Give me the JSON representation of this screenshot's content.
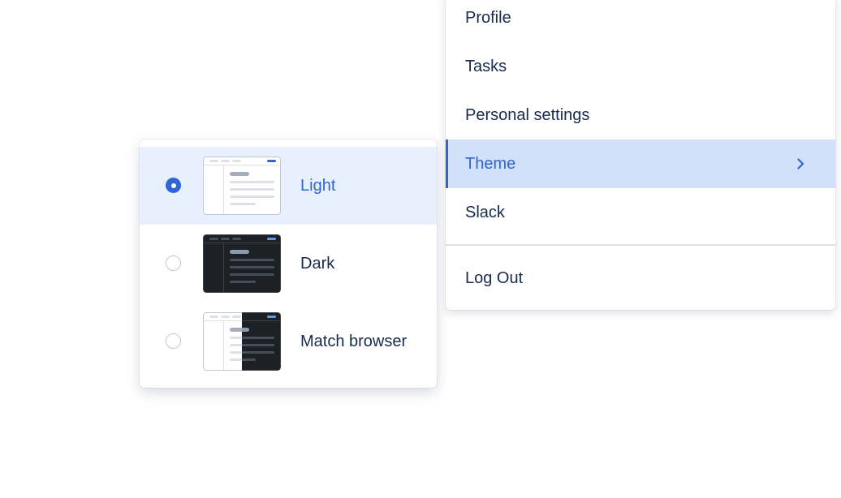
{
  "user_menu": {
    "items": [
      {
        "label": "Profile"
      },
      {
        "label": "Tasks"
      },
      {
        "label": "Personal settings"
      },
      {
        "label": "Theme",
        "selected": true,
        "icon": "chevron-right-icon"
      },
      {
        "label": "Slack"
      }
    ],
    "logout_label": "Log Out"
  },
  "theme_submenu": {
    "options": [
      {
        "label": "Light",
        "selected": true,
        "preview": "light-theme-preview"
      },
      {
        "label": "Dark",
        "selected": false,
        "preview": "dark-theme-preview"
      },
      {
        "label": "Match browser",
        "selected": false,
        "preview": "match-browser-theme-preview"
      }
    ]
  },
  "colors": {
    "accent": "#2f66d4",
    "selected_menu_bg": "#d2e0f9",
    "selected_option_bg": "#e9f0fd",
    "text": "#172b4d"
  }
}
